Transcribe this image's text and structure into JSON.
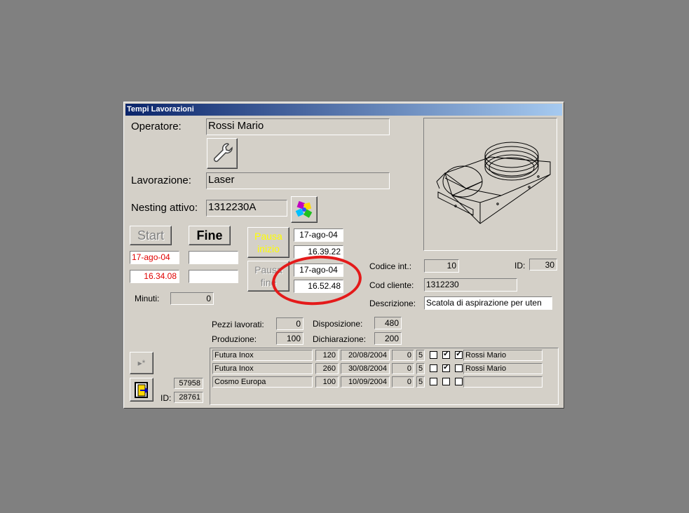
{
  "window": {
    "title": "Tempi Lavorazioni"
  },
  "operatore": {
    "label": "Operatore:",
    "value": "Rossi Mario"
  },
  "lavorazione": {
    "label": "Lavorazione:",
    "value": "Laser"
  },
  "nesting": {
    "label": "Nesting attivo:",
    "value": "1312230A"
  },
  "buttons": {
    "start": "Start",
    "fine": "Fine",
    "pausa_inizio": "Pausa\ninizio",
    "pausa_fine": "Pausa\nfine"
  },
  "start_values": {
    "date": "17-ago-04",
    "time": "16.34.08"
  },
  "pausa_inizio_values": {
    "date": "17-ago-04",
    "time": "16.39.22"
  },
  "pausa_fine_values": {
    "date": "17-ago-04",
    "time": "16.52.48"
  },
  "minuti": {
    "label": "Minuti:",
    "value": "0"
  },
  "codice_int": {
    "label": "Codice  int.:",
    "value": "10"
  },
  "id_top": {
    "label": "ID:",
    "value": "30"
  },
  "cod_cliente": {
    "label": "Cod cliente:",
    "value": "1312230"
  },
  "descrizione": {
    "label": "Descrizione:",
    "value": "Scatola di aspirazione per uten"
  },
  "pezzi_lavorati": {
    "label": "Pezzi lavorati:",
    "value": "0"
  },
  "produzione": {
    "label": "Produzione:",
    "value": "100"
  },
  "disposizione": {
    "label": "Disposizione:",
    "value": "480"
  },
  "dichiarazione": {
    "label": "Dichiarazione:",
    "value": "200"
  },
  "bottom": {
    "record": "57958",
    "id_label": "ID:",
    "id_value": "28761",
    "new_record_icon": "new-record-icon",
    "exit_icon": "exit-door-icon"
  },
  "orders": [
    {
      "cliente": "Futura Inox",
      "qty": "120",
      "date": "20/08/2004",
      "n": "0",
      "k": "5",
      "c1": false,
      "c2": true,
      "c3": true,
      "operatore": "Rossi Mario"
    },
    {
      "cliente": "Futura Inox",
      "qty": "260",
      "date": "30/08/2004",
      "n": "0",
      "k": "5",
      "c1": false,
      "c2": true,
      "c3": false,
      "operatore": "Rossi Mario"
    },
    {
      "cliente": "Cosmo Europa",
      "qty": "100",
      "date": "10/09/2004",
      "n": "0",
      "k": "5",
      "c1": false,
      "c2": false,
      "c3": false,
      "operatore": ""
    }
  ],
  "colors": {
    "highlight_circle": "#e41a1a",
    "red_text": "#e00000",
    "pause_text": "#ffff00"
  },
  "icons": {
    "tool": "wrench-icon",
    "nesting": "puzzle-icon"
  }
}
